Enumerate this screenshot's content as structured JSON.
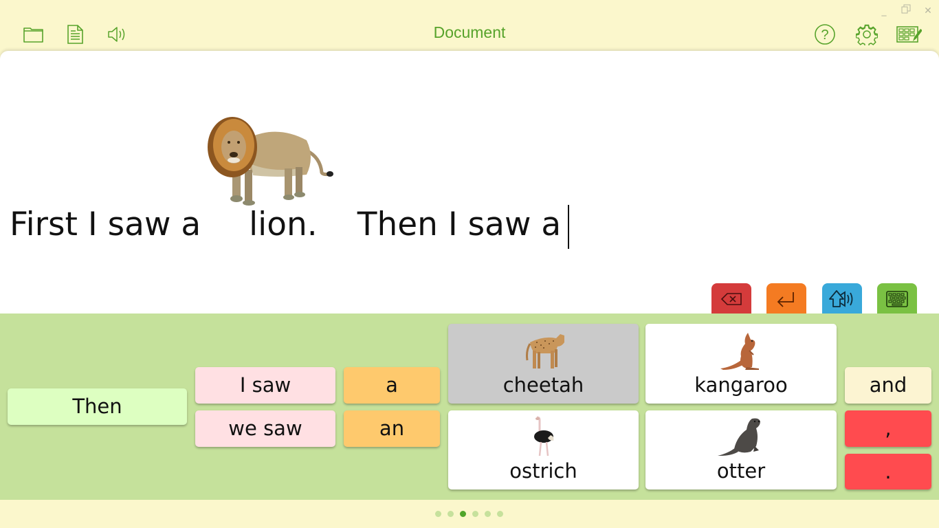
{
  "window": {
    "minimize_icon": "minimize-icon",
    "maximize_icon": "restore-icon",
    "close_icon": "close-icon",
    "minimize_glyph": "_",
    "close_glyph": "✕"
  },
  "toolbar": {
    "title": "Document",
    "left_icons": [
      "folder-icon",
      "document-icon",
      "speaker-icon"
    ],
    "right_icons": [
      "help-icon",
      "gear-icon",
      "grid-edit-icon"
    ],
    "accent": "#57a32b"
  },
  "document": {
    "segments": [
      {
        "type": "text",
        "value": "First I saw a"
      },
      {
        "type": "symbol",
        "word": "lion",
        "icon": "lion-picture"
      },
      {
        "type": "text",
        "value": "lion."
      },
      {
        "type": "text",
        "value": "Then I saw a"
      }
    ],
    "text_part1": "First I saw a",
    "text_part2": "lion.",
    "text_part3": "Then I saw a"
  },
  "nav": {
    "back_icon": "arrow-left-icon",
    "forward_icon": "arrow-right-icon"
  },
  "actions": [
    {
      "name": "backspace",
      "icon": "backspace-icon",
      "color": "#d43b3b"
    },
    {
      "name": "enter",
      "icon": "enter-icon",
      "color": "#f47b22"
    },
    {
      "name": "speak",
      "icon": "speak-shift-icon",
      "color": "#39a9da"
    },
    {
      "name": "keyboard",
      "icon": "keyboard-icon",
      "color": "#7ac143"
    }
  ],
  "grid": {
    "cells": [
      {
        "label": "Then",
        "color": "#ddffc1"
      },
      {
        "label": "I saw",
        "color": "#ffe0e3"
      },
      {
        "label": "we saw",
        "color": "#ffe0e3"
      },
      {
        "label": "a",
        "color": "#fec96d"
      },
      {
        "label": "an",
        "color": "#fec96d"
      },
      {
        "label": "cheetah",
        "picture": "cheetah-picture",
        "color": "#cacaca",
        "highlighted": true
      },
      {
        "label": "kangaroo",
        "picture": "kangaroo-picture",
        "color": "#ffffff"
      },
      {
        "label": "ostrich",
        "picture": "ostrich-picture",
        "color": "#ffffff"
      },
      {
        "label": "otter",
        "picture": "otter-picture",
        "color": "#ffffff"
      },
      {
        "label": "and",
        "color": "#fcf4d2"
      },
      {
        "label": ",",
        "color": "#ff4b4f"
      },
      {
        "label": ".",
        "color": "#ff4b4f"
      }
    ]
  },
  "pager": {
    "total_pages": 6,
    "current_page": 3
  }
}
